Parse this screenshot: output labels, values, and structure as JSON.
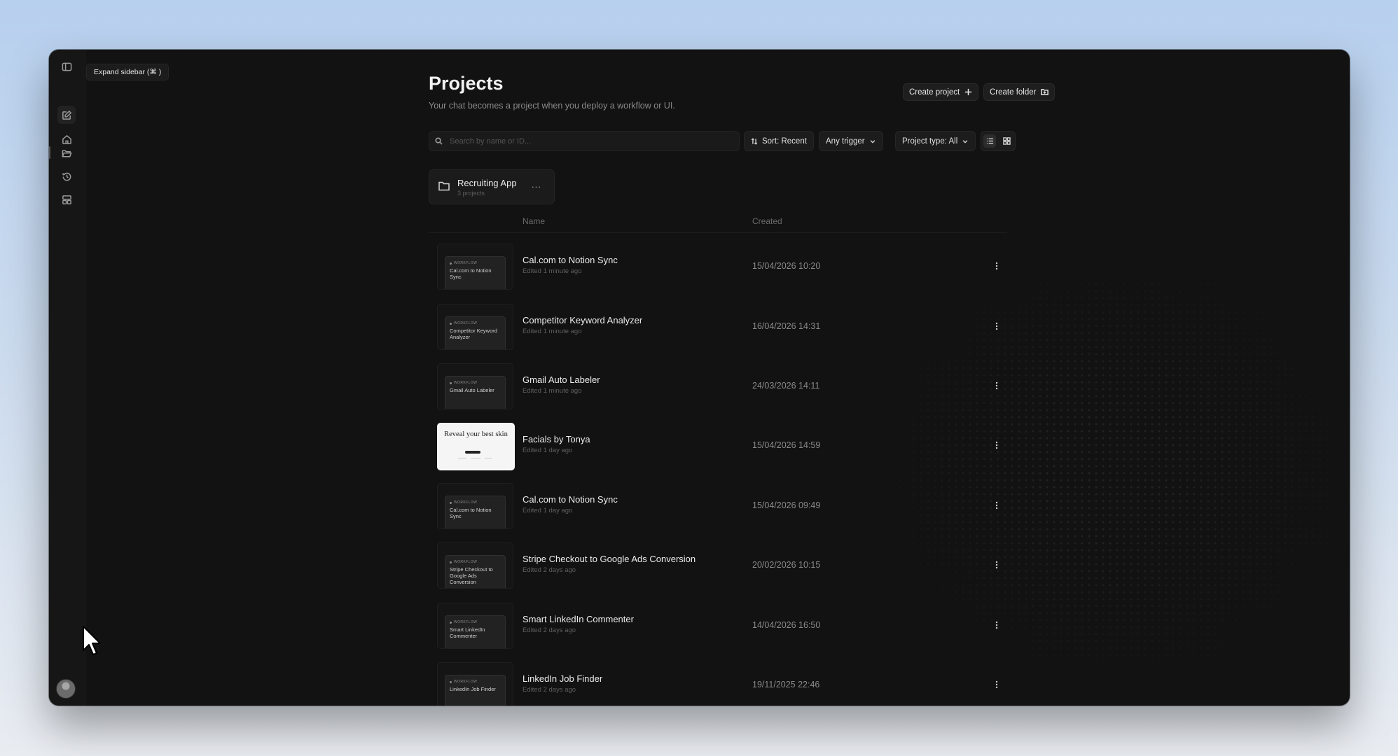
{
  "sidebar": {
    "tooltip": "Expand sidebar (⌘ )",
    "icons": [
      "sidebar-toggle-icon",
      "new-chat-icon",
      "home-icon",
      "folder-open-icon",
      "history-icon",
      "templates-icon"
    ]
  },
  "header": {
    "title": "Projects",
    "subtitle": "Your chat becomes a project when you deploy a workflow or UI.",
    "create_project_label": "Create project",
    "create_folder_label": "Create folder"
  },
  "toolbar": {
    "search_placeholder": "Search by name or ID...",
    "sort_label": "Sort: Recent",
    "trigger_label": "Any trigger",
    "type_label": "Project type: All",
    "view_mode": "list"
  },
  "folder": {
    "name": "Recruiting App",
    "count": "3 projects",
    "menu": "..."
  },
  "table": {
    "col_name": "Name",
    "col_created": "Created",
    "rows": [
      {
        "name": "Cal.com to Notion Sync",
        "edited": "Edited 1 minute ago",
        "created": "15/04/2026 10:20",
        "thumb_tag": "WORKFLOW",
        "thumb_title": "Cal.com to Notion Sync"
      },
      {
        "name": "Competitor Keyword Analyzer",
        "edited": "Edited 1 minute ago",
        "created": "16/04/2026 14:31",
        "thumb_tag": "WORKFLOW",
        "thumb_title": "Competitor Keyword Analyzer"
      },
      {
        "name": "Gmail Auto Labeler",
        "edited": "Edited 1 minute ago",
        "created": "24/03/2026 14:11",
        "thumb_tag": "WORKFLOW",
        "thumb_title": "Gmail Auto Labeler"
      },
      {
        "name": "Facials by Tonya",
        "edited": "Edited 1 day ago",
        "created": "15/04/2026 14:59",
        "thumb_title": "Reveal your best skin"
      },
      {
        "name": "Cal.com to Notion Sync",
        "edited": "Edited 1 day ago",
        "created": "15/04/2026 09:49",
        "thumb_tag": "WORKFLOW",
        "thumb_title": "Cal.com to Notion Sync"
      },
      {
        "name": "Stripe Checkout to Google Ads Conversion",
        "edited": "Edited 2 days ago",
        "created": "20/02/2026 10:15",
        "thumb_tag": "WORKFLOW",
        "thumb_title": "Stripe Checkout to Google Ads Conversion"
      },
      {
        "name": "Smart LinkedIn Commenter",
        "edited": "Edited 2 days ago",
        "created": "14/04/2026 16:50",
        "thumb_tag": "WORKFLOW",
        "thumb_title": "Smart LinkedIn Commenter"
      },
      {
        "name": "LinkedIn Job Finder",
        "edited": "Edited 2 days ago",
        "created": "19/11/2025 22:46",
        "thumb_tag": "WORKFLOW",
        "thumb_title": "LinkedIn Job Finder"
      }
    ]
  },
  "colors": {
    "background": "#121212",
    "surface": "#1c1c1c",
    "text": "#ececec",
    "muted": "#8a8a8a"
  }
}
